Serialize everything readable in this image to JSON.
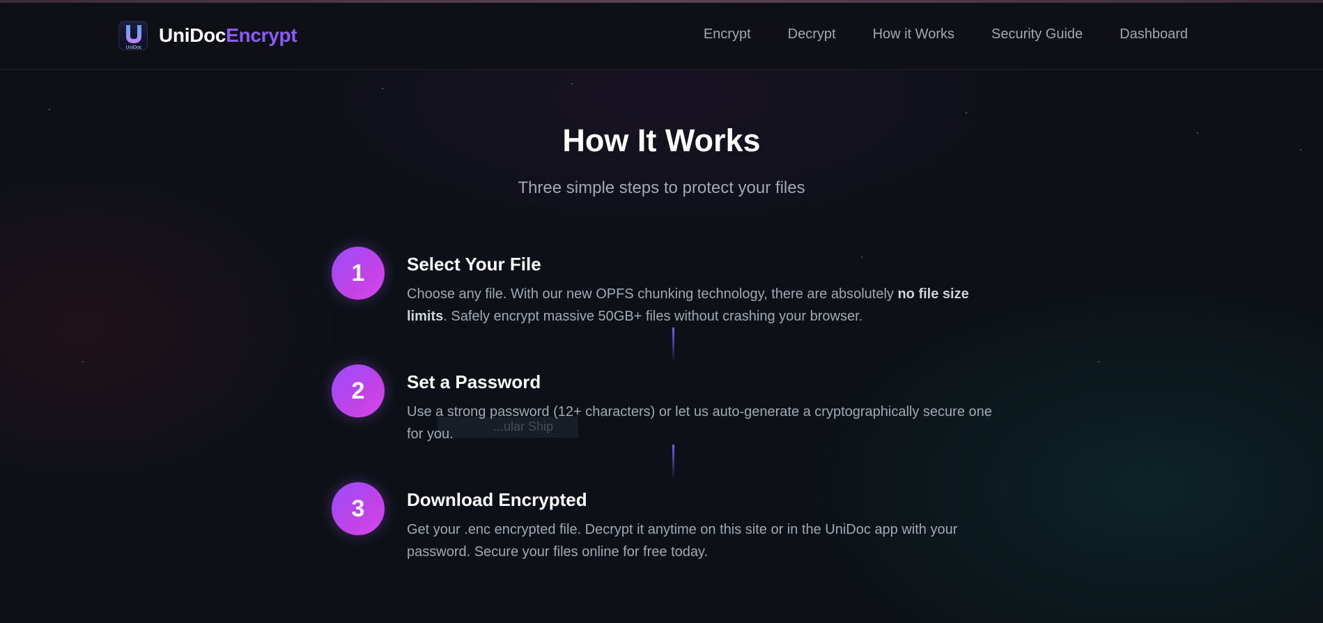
{
  "brand": {
    "name_part1": "UniDoc",
    "name_part2": "Encrypt",
    "logo_icon": "unidoc-logo-icon",
    "logo_text": "UniDoc"
  },
  "nav": {
    "items": [
      {
        "label": "Encrypt"
      },
      {
        "label": "Decrypt"
      },
      {
        "label": "How it Works"
      },
      {
        "label": "Security Guide"
      },
      {
        "label": "Dashboard"
      }
    ]
  },
  "hero": {
    "title": "How It Works",
    "subtitle": "Three simple steps to protect your files"
  },
  "steps": [
    {
      "number": "1",
      "title": "Select Your File",
      "desc_part1": "Choose any file. With our new OPFS chunking technology, there are absolutely ",
      "desc_bold": "no file size limits",
      "desc_part2": ". Safely encrypt massive 50GB+ files without crashing your browser."
    },
    {
      "number": "2",
      "title": "Set a Password",
      "desc": "Use a strong password (12+ characters) or let us auto-generate a cryptographically secure one for you."
    },
    {
      "number": "3",
      "title": "Download Encrypted",
      "desc": "Get your .enc encrypted file. Decrypt it anytime on this site or in the UniDoc app with your password. Secure your files online for free today."
    }
  ],
  "ghost_text": "...ular Ship",
  "colors": {
    "accent": "#8b5cf6",
    "step_gradient_start": "#9b4dff",
    "step_gradient_end": "#d946ef",
    "background": "#0d1117",
    "muted_text": "#a3a8b4"
  }
}
